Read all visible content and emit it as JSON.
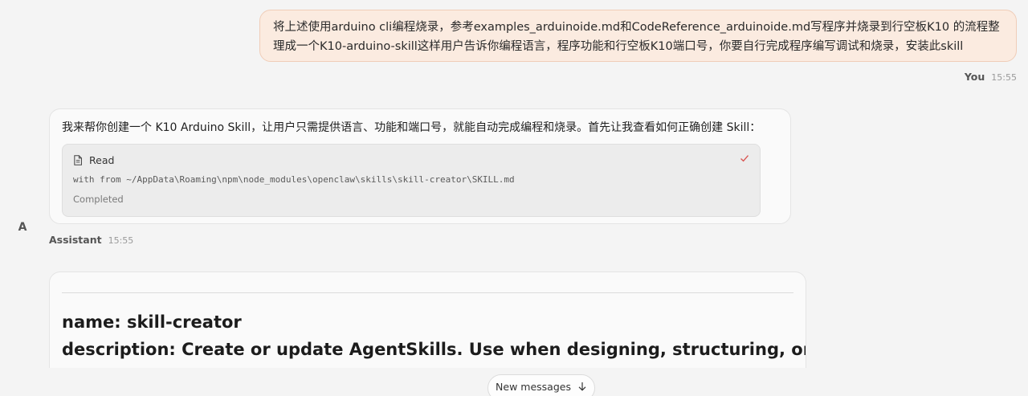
{
  "user_message": {
    "text": "将上述使用arduino cli编程烧录，参考examples_arduinoide.md和CodeReference_arduinoide.md写程序并烧录到行空板K10 的流程整理成一个K10-arduino-skill这样用户告诉你编程语言，程序功能和行空板K10端口号，你要自行完成程序编写调试和烧录，安装此skill",
    "author": "You",
    "time": "15:55"
  },
  "assistant_message": {
    "avatar_letter": "A",
    "text": "我来帮你创建一个 K10 Arduino Skill，让用户只需提供语言、功能和端口号，就能自动完成编程和烧录。首先让我查看如何正确创建 Skill：",
    "author": "Assistant",
    "time": "15:55",
    "tool": {
      "name": "Read",
      "icon": "document-icon",
      "status_icon": "check-icon",
      "path": "with from ~/AppData\\Roaming\\npm\\node_modules\\openclaw\\skills\\skill-creator\\SKILL.md",
      "status": "Completed",
      "accent": "#d9534f"
    }
  },
  "content_message": {
    "line1": "name: skill-creator",
    "line2": "description: Create or update AgentSkills. Use when designing, structuring, or packaging"
  },
  "new_messages": {
    "label": "New messages",
    "icon": "arrow-down-icon"
  }
}
